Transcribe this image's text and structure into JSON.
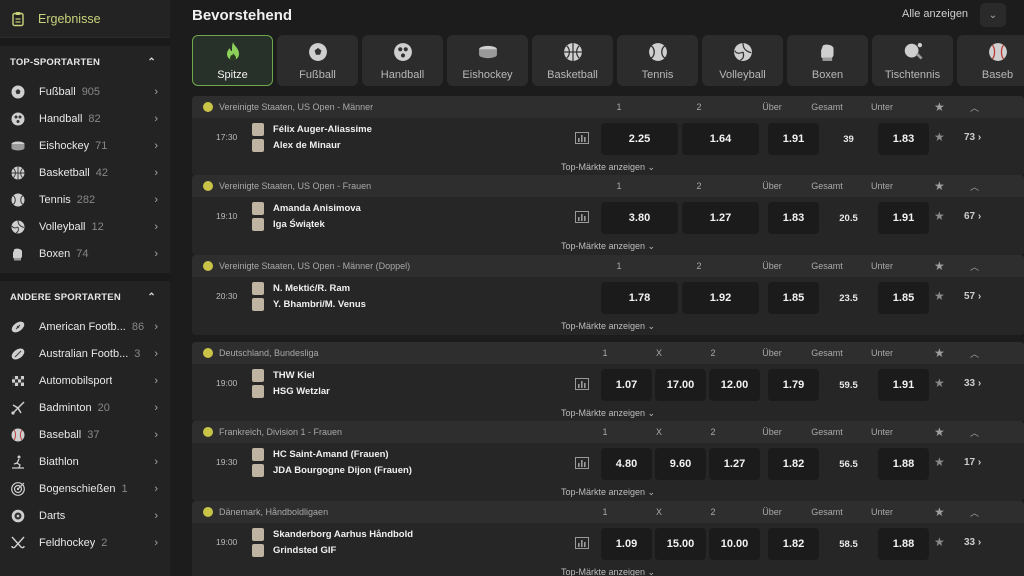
{
  "sidebar": {
    "results_label": "Ergebnisse",
    "top_title": "TOP-SPORTARTEN",
    "top_items": [
      {
        "label": "Fußball",
        "count": "905",
        "icon": "soccer-icon"
      },
      {
        "label": "Handball",
        "count": "82",
        "icon": "handball-icon"
      },
      {
        "label": "Eishockey",
        "count": "71",
        "icon": "hockey-icon"
      },
      {
        "label": "Basketball",
        "count": "42",
        "icon": "basketball-icon"
      },
      {
        "label": "Tennis",
        "count": "282",
        "icon": "tennis-icon"
      },
      {
        "label": "Volleyball",
        "count": "12",
        "icon": "volleyball-icon"
      },
      {
        "label": "Boxen",
        "count": "74",
        "icon": "boxing-icon"
      }
    ],
    "other_title": "ANDERE SPORTARTEN",
    "other_items": [
      {
        "label": "American Footb...",
        "count": "86",
        "icon": "american-football-icon"
      },
      {
        "label": "Australian Footb...",
        "count": "3",
        "icon": "australian-football-icon"
      },
      {
        "label": "Automobilsport",
        "count": "",
        "icon": "racing-flag-icon"
      },
      {
        "label": "Badminton",
        "count": "20",
        "icon": "badminton-icon"
      },
      {
        "label": "Baseball",
        "count": "37",
        "icon": "baseball-icon"
      },
      {
        "label": "Biathlon",
        "count": "",
        "icon": "biathlon-icon"
      },
      {
        "label": "Bogenschießen",
        "count": "1",
        "icon": "archery-icon"
      },
      {
        "label": "Darts",
        "count": "",
        "icon": "darts-icon"
      },
      {
        "label": "Feldhockey",
        "count": "2",
        "icon": "field-hockey-icon"
      }
    ]
  },
  "main": {
    "title": "Bevorstehend",
    "show_all": "Alle anzeigen",
    "tabs": [
      {
        "label": "Spitze",
        "icon": "flame-icon",
        "active": true
      },
      {
        "label": "Fußball",
        "icon": "soccer-icon"
      },
      {
        "label": "Handball",
        "icon": "handball-icon"
      },
      {
        "label": "Eishockey",
        "icon": "hockey-icon"
      },
      {
        "label": "Basketball",
        "icon": "basketball-icon"
      },
      {
        "label": "Tennis",
        "icon": "tennis-icon"
      },
      {
        "label": "Volleyball",
        "icon": "volleyball-icon"
      },
      {
        "label": "Boxen",
        "icon": "boxing-icon"
      },
      {
        "label": "Tischtennis",
        "icon": "table-tennis-icon"
      },
      {
        "label": "Baseb",
        "icon": "baseball-icon"
      }
    ]
  },
  "events": [
    {
      "league": "Vereinigte Staaten, US Open - Männer",
      "cols": [
        "1",
        "2",
        "Über",
        "Gesamt",
        "Unter"
      ],
      "time": "17:30",
      "team1": "Félix Auger-Aliassime",
      "team2": "Alex de Minaur",
      "odds": [
        "2.25",
        "1.64"
      ],
      "over": "1.91",
      "total": "39",
      "under": "1.83",
      "more": "73 ›",
      "footer": "Top-Märkte anzeigen ⌄"
    },
    {
      "league": "Vereinigte Staaten, US Open - Frauen",
      "cols": [
        "1",
        "2",
        "Über",
        "Gesamt",
        "Unter"
      ],
      "time": "19:10",
      "team1": "Amanda Anisimova",
      "team2": "Iga Świątek",
      "odds": [
        "3.80",
        "1.27"
      ],
      "over": "1.83",
      "total": "20.5",
      "under": "1.91",
      "more": "67 ›",
      "footer": "Top-Märkte anzeigen ⌄"
    },
    {
      "league": "Vereinigte Staaten, US Open - Männer (Doppel)",
      "cols": [
        "1",
        "2",
        "Über",
        "Gesamt",
        "Unter"
      ],
      "time": "20:30",
      "team1": "N. Mektić/R. Ram",
      "team2": "Y. Bhambri/M. Venus",
      "odds": [
        "1.78",
        "1.92"
      ],
      "over": "1.85",
      "total": "23.5",
      "under": "1.85",
      "more": "57 ›",
      "footer": "Top-Märkte anzeigen ⌄"
    },
    {
      "league": "Deutschland, Bundesliga",
      "cols": [
        "1",
        "X",
        "2",
        "Über",
        "Gesamt",
        "Unter"
      ],
      "time": "19:00",
      "team1": "THW Kiel",
      "team2": "HSG Wetzlar",
      "odds": [
        "1.07",
        "17.00",
        "12.00"
      ],
      "over": "1.79",
      "total": "59.5",
      "under": "1.91",
      "more": "33 ›",
      "footer": "Top-Märkte anzeigen ⌄"
    },
    {
      "league": "Frankreich, Division 1 - Frauen",
      "cols": [
        "1",
        "X",
        "2",
        "Über",
        "Gesamt",
        "Unter"
      ],
      "time": "19:30",
      "team1": "HC Saint-Amand (Frauen)",
      "team2": "JDA Bourgogne Dijon (Frauen)",
      "odds": [
        "4.80",
        "9.60",
        "1.27"
      ],
      "over": "1.82",
      "total": "56.5",
      "under": "1.88",
      "more": "17 ›",
      "footer": "Top-Märkte anzeigen ⌄"
    },
    {
      "league": "Dänemark, Håndboldligaen",
      "cols": [
        "1",
        "X",
        "2",
        "Über",
        "Gesamt",
        "Unter"
      ],
      "time": "19:00",
      "team1": "Skanderborg Aarhus Håndbold",
      "team2": "Grindsted GIF",
      "odds": [
        "1.09",
        "15.00",
        "10.00"
      ],
      "over": "1.82",
      "total": "58.5",
      "under": "1.88",
      "more": "33 ›",
      "footer": "Top-Märkte anzeigen ⌄"
    }
  ]
}
